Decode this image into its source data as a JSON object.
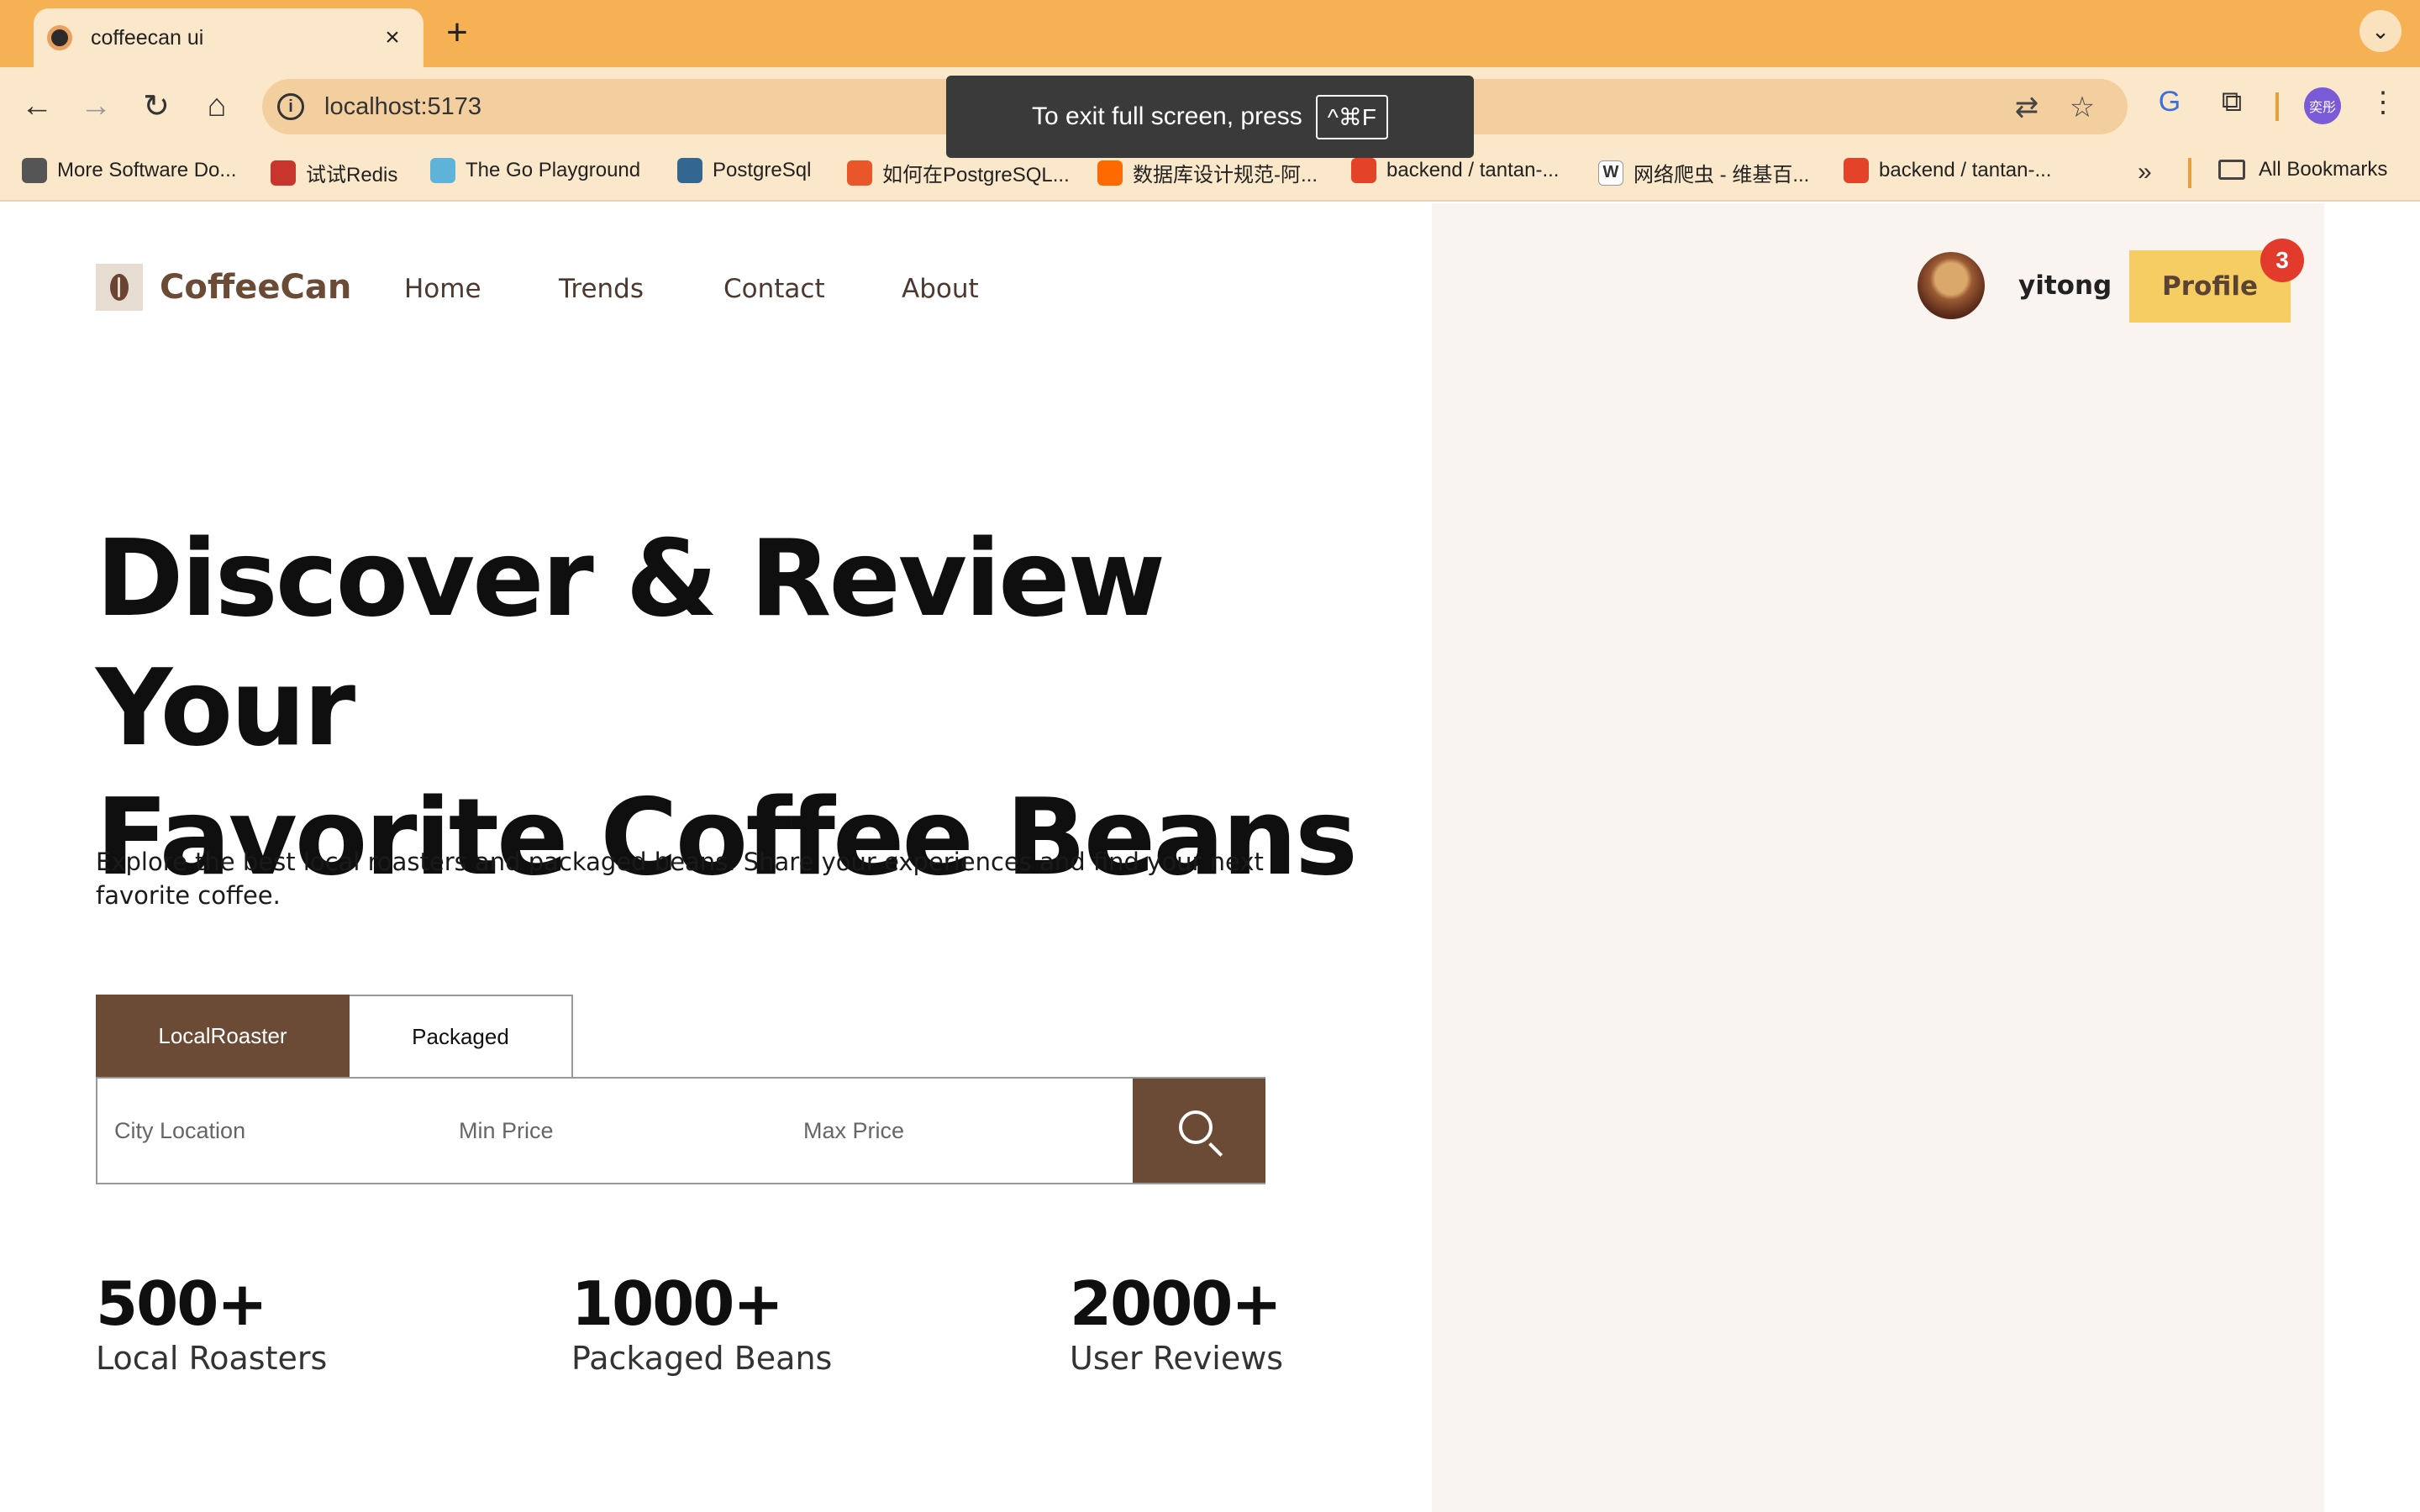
{
  "browser": {
    "tab_title": "coffeecan ui",
    "tab_close": "×",
    "new_tab": "+",
    "tabs_menu": "⌄",
    "url": "localhost:5173",
    "profile_initials": "奕彤",
    "fullscreen_toast": {
      "text": "To exit full screen, press",
      "key": "^⌘F"
    },
    "bookmarks": [
      {
        "label": "More Software Do...",
        "icon": "apple-icon",
        "color": "#555555"
      },
      {
        "label": "试试Redis",
        "icon": "redis-icon",
        "color": "#c8352d"
      },
      {
        "label": "The Go Playground",
        "icon": "gopher-icon",
        "color": "#5fb3d9"
      },
      {
        "label": "PostgreSql",
        "icon": "elephant-icon",
        "color": "#336791"
      },
      {
        "label": "如何在PostgreSQL...",
        "icon": "flame-icon",
        "color": "#e8562a"
      },
      {
        "label": "数据库设计规范-阿...",
        "icon": "aliyun-icon",
        "color": "#ff6a00"
      },
      {
        "label": "backend / tantan-...",
        "icon": "gitlab-icon",
        "color": "#e24329"
      },
      {
        "label": "网络爬虫 - 维基百...",
        "icon": "wikipedia-icon",
        "color": "#333333"
      },
      {
        "label": "backend / tantan-...",
        "icon": "gitlab-icon",
        "color": "#e24329"
      }
    ],
    "bookmarks_overflow": "»",
    "all_bookmarks": "All Bookmarks"
  },
  "header": {
    "brand": "CoffeeCan",
    "nav": [
      "Home",
      "Trends",
      "Contact",
      "About"
    ],
    "username": "yitong",
    "profile_button": "Profile",
    "notification_count": "3"
  },
  "hero": {
    "title_line1": "Discover & Review Your",
    "title_line2": "Favorite Coffee Beans",
    "subtitle": "Explore the best local roasters and packaged beans. Share your experiences and find your next favorite coffee."
  },
  "search": {
    "tabs": [
      "LocalRoaster",
      "Packaged"
    ],
    "active_tab": "LocalRoaster",
    "city_placeholder": "City Location",
    "min_price_placeholder": "Min Price",
    "max_price_placeholder": "Max Price"
  },
  "stats": [
    {
      "value": "500+",
      "label": "Local Roasters"
    },
    {
      "value": "1000+",
      "label": "Packaged Beans"
    },
    {
      "value": "2000+",
      "label": "User Reviews"
    }
  ],
  "colors": {
    "chrome_accent": "#f6b154",
    "brand_brown": "#6b4a36",
    "profile_yellow": "#f6cd62",
    "badge_red": "#e33b2b",
    "panel_bg": "#faf4f1"
  }
}
